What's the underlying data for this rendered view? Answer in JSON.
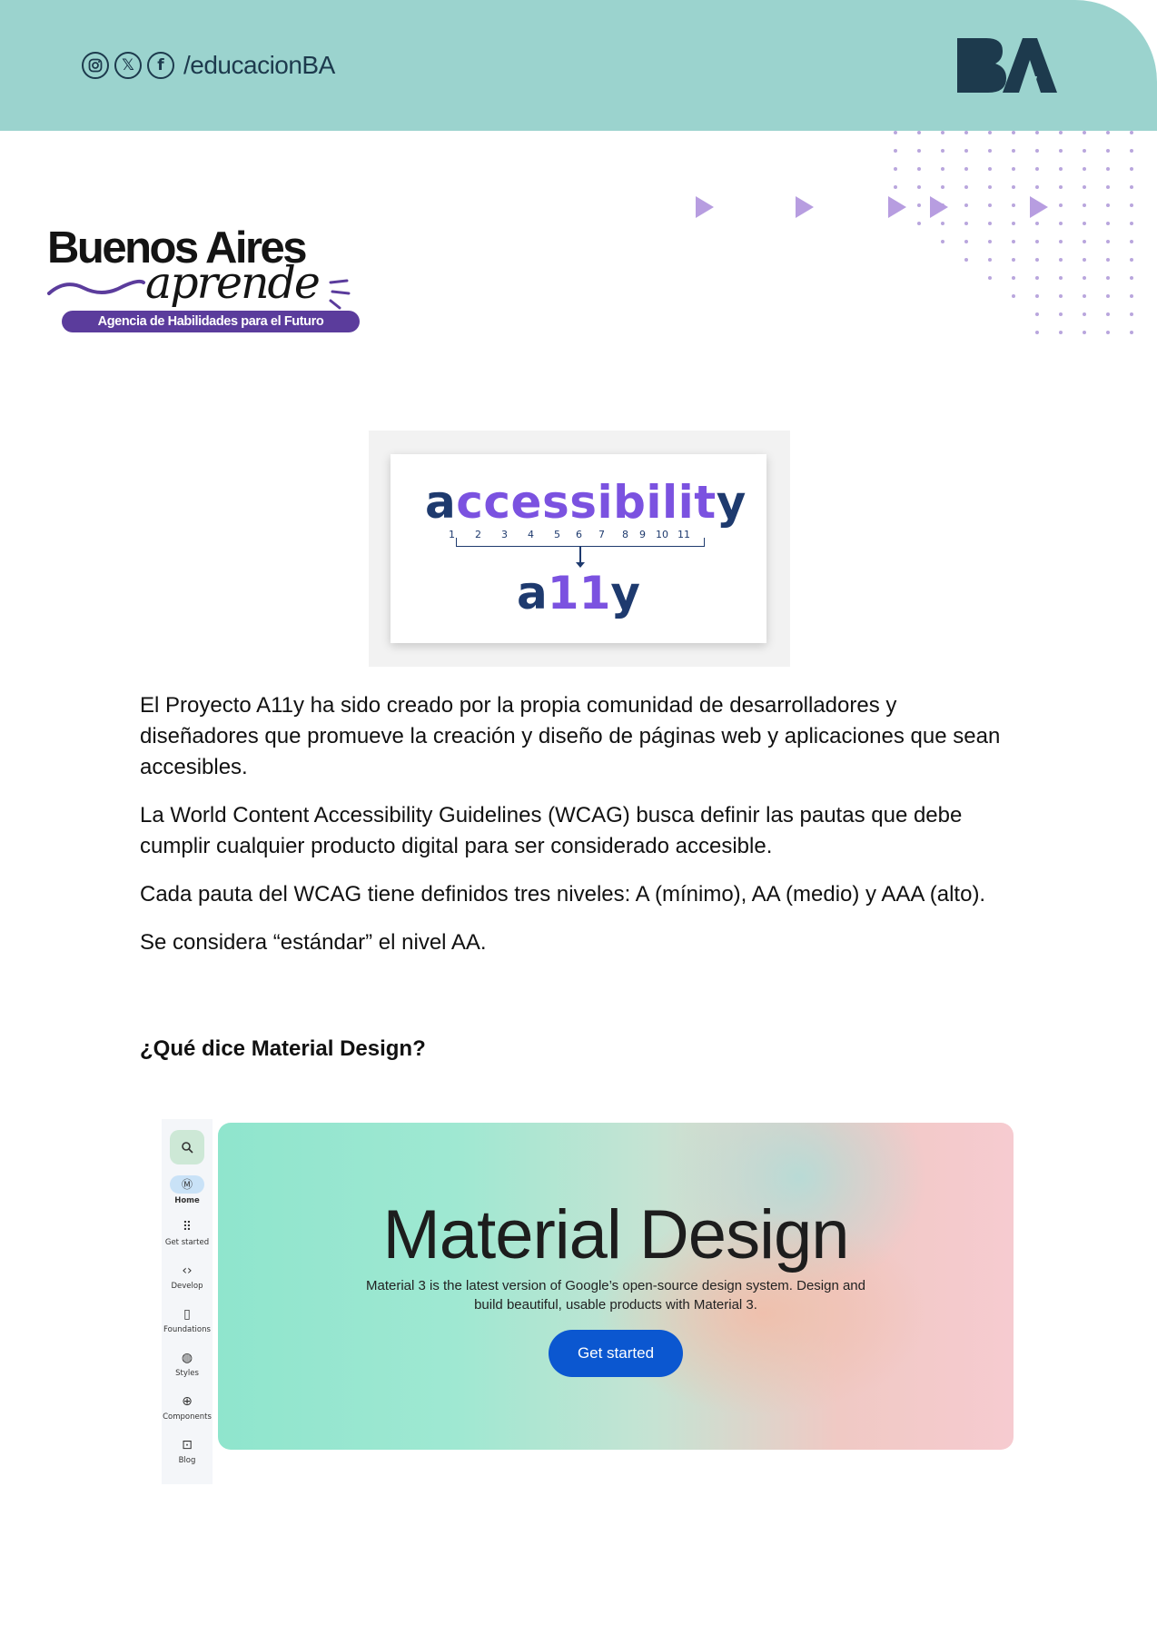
{
  "header": {
    "social_icons": [
      "instagram-icon",
      "x-icon",
      "facebook-icon"
    ],
    "handle": "/educacionBA",
    "logo_text": "BA",
    "colors": {
      "band": "#9bd3ce",
      "logo": "#1d3a4d"
    }
  },
  "brand": {
    "line1": "Buenos Aires",
    "line2": "aprende",
    "tagline": "Agencia de Habilidades para el Futuro",
    "accent": "#5b3c9c"
  },
  "a11y_figure": {
    "first_letter": "a",
    "middle_letters": "ccessibilit",
    "last_letter": "y",
    "numbers": [
      "1",
      "2",
      "3",
      "4",
      "5",
      "6",
      "7",
      "8",
      "9",
      "10",
      "11"
    ],
    "short_first": "a",
    "short_mid": "11",
    "short_last": "y",
    "colors": {
      "dark": "#1e3a6e",
      "accent": "#7b52e0"
    }
  },
  "paragraphs": [
    "El Proyecto A11y ha sido creado por la propia comunidad de desarrolladores y diseñadores que promueve la creación y diseño de páginas web y aplicaciones que sean accesibles.",
    "La World Content Accessibility Guidelines (WCAG) busca definir las pautas que debe cumplir cualquier producto digital para ser considerado accesible.",
    "Cada pauta del WCAG tiene definidos tres niveles: A (mínimo), AA (medio) y AAA (alto).",
    "Se considera “estándar” el nivel AA."
  ],
  "section_heading": "¿Qué dice Material Design?",
  "material_screenshot": {
    "nav": [
      {
        "label": "Home",
        "icon": "material-logo-icon"
      },
      {
        "label": "Get started",
        "icon": "apps-grid-icon"
      },
      {
        "label": "Develop",
        "icon": "code-icon"
      },
      {
        "label": "Foundations",
        "icon": "book-icon"
      },
      {
        "label": "Styles",
        "icon": "palette-icon"
      },
      {
        "label": "Components",
        "icon": "add-circle-icon"
      },
      {
        "label": "Blog",
        "icon": "blog-icon"
      }
    ],
    "hero_title": "Material Design",
    "hero_subtitle": "Material 3 is the latest version of Google’s open-source design system. Design and build beautiful, usable products with Material 3.",
    "cta_label": "Get started",
    "cta_color": "#0b57d0"
  }
}
